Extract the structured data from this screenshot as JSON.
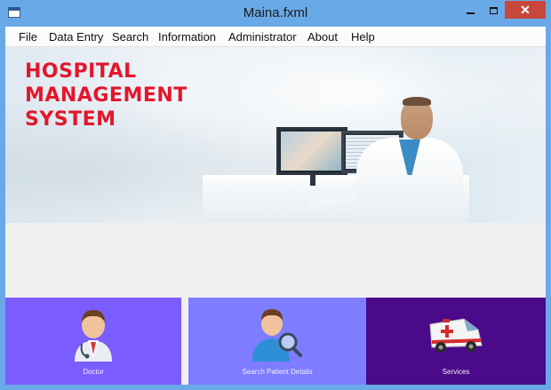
{
  "window": {
    "title": "Maina.fxml"
  },
  "menu": {
    "items": [
      "File",
      "Data Entry",
      "Search",
      "Information",
      "Administrator",
      "About",
      "Help"
    ]
  },
  "banner": {
    "title_lines": [
      "HOSPITAL",
      "MANAGEMENT",
      "SYSTEM"
    ],
    "title_color": "#e3162b"
  },
  "tiles": [
    {
      "label": "Doctor",
      "icon": "doctor-icon",
      "color": "#7b5cff"
    },
    {
      "label": "Search Patient Details",
      "icon": "search-patient-icon",
      "color": "#7e7cff"
    },
    {
      "label": "Services",
      "icon": "ambulance-icon",
      "color": "#4a0a8a"
    }
  ]
}
